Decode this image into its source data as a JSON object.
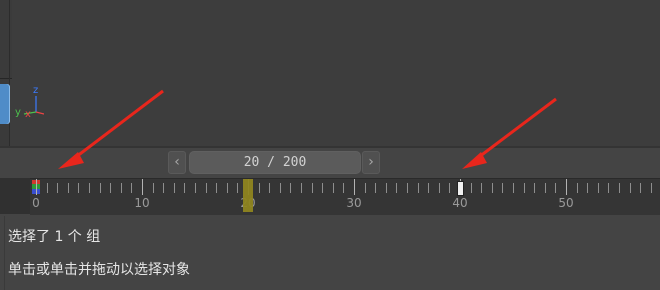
{
  "viewport": {
    "gizmo": {
      "x": "x",
      "y": "y",
      "z": "z"
    }
  },
  "navigator": {
    "prev_icon": "chevron-left-icon",
    "next_icon": "chevron-right-icon",
    "prev_glyph": "‹",
    "next_glyph": "›",
    "frame_display": "20 / 200"
  },
  "timeline": {
    "current_frame": 20,
    "total_frames": 200,
    "keyframe": 40,
    "labels": [
      "0",
      "10",
      "20",
      "30",
      "40",
      "50"
    ]
  },
  "status": {
    "selection": "选择了 1 个 组",
    "prompt": "单击或单击并拖动以选择对象"
  },
  "colors": {
    "background": "#444444",
    "viewport": "#3d3d3d",
    "timeline": "#353535",
    "cursor": "#8f8520",
    "annotation_arrow": "#e8261c"
  }
}
